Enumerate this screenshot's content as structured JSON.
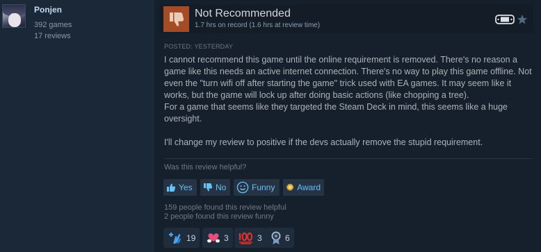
{
  "author": {
    "name": "Ponjen",
    "games": "392 games",
    "reviews": "17 reviews"
  },
  "header": {
    "verdict": "Not Recommended",
    "hours": "1.7 hrs on record (1.6 hrs at review time)"
  },
  "posted": "POSTED: YESTERDAY",
  "content": {
    "paragraph1": "I cannot recommend this game until the online requirement is removed. There's no reason a game like this needs an active internet connection. There's no way to play this game offline. Not even the \"turn wifi off after starting the game\" trick used with EA games. It may seem like it works, but the game will lock up after doing basic actions (like chopping a tree).",
    "paragraph2": "For a game that seems like they targeted the Steam Deck in mind, this seems like a huge oversight.",
    "paragraph3": "I'll change my review to positive if the devs actually remove the stupid requirement."
  },
  "helpful": {
    "question": "Was this review helpful?",
    "yes_label": "Yes",
    "no_label": "No",
    "funny_label": "Funny",
    "award_label": "Award"
  },
  "stats": {
    "helpful_text": "159 people found this review helpful",
    "funny_text": "2 people found this review funny"
  },
  "awards": [
    {
      "icon": "clap-plus-icon",
      "count": "19"
    },
    {
      "icon": "heart-hands-icon",
      "count": "3"
    },
    {
      "icon": "hundred-points-icon",
      "count": "3"
    },
    {
      "icon": "medal-icon",
      "count": "6"
    }
  ],
  "colors": {
    "background": "#1b2838",
    "review_bg": "#16202d",
    "thumb_down": "#a34c25",
    "link_blue": "#67c1f5",
    "author_name": "#c1dbf4"
  }
}
